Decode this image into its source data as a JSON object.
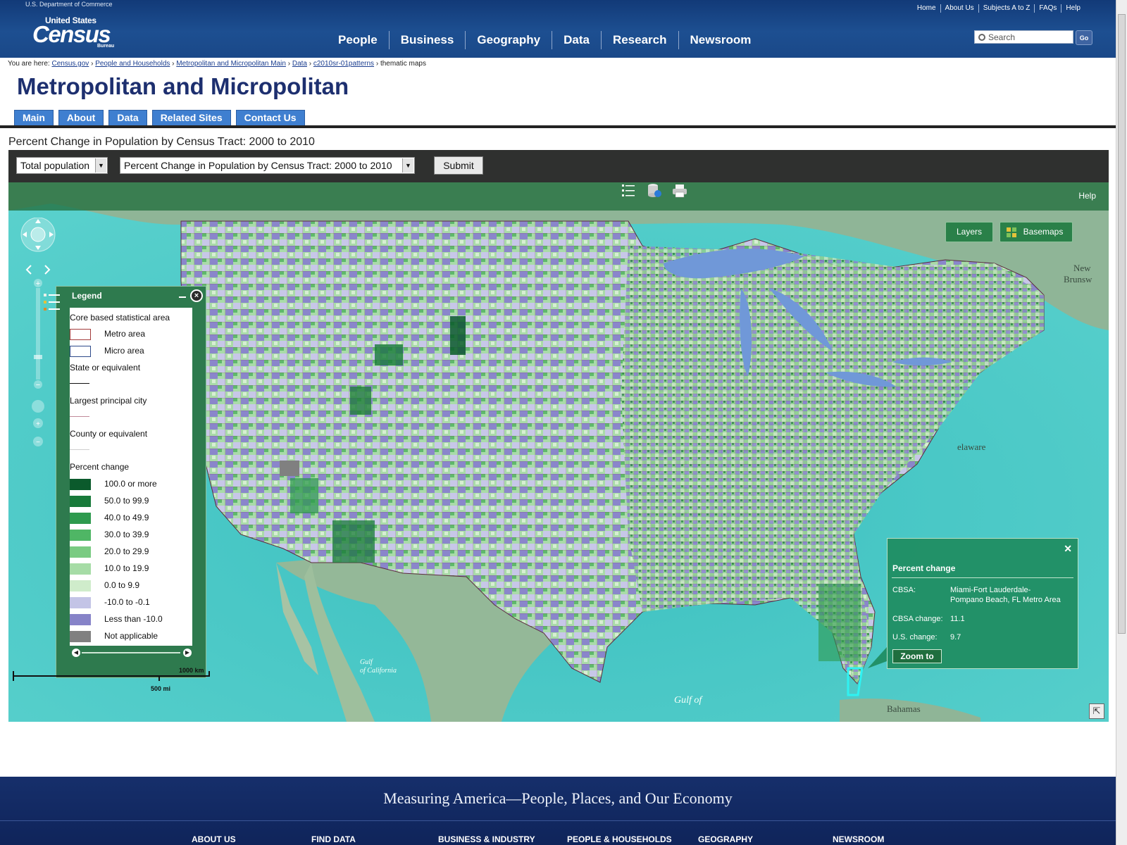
{
  "header": {
    "department": "U.S. Department of Commerce",
    "logo": {
      "top": "United States",
      "main": "Census",
      "sub": "Bureau"
    },
    "utility_links": [
      "Home",
      "About Us",
      "Subjects A to Z",
      "FAQs",
      "Help"
    ],
    "nav": [
      "People",
      "Business",
      "Geography",
      "Data",
      "Research",
      "Newsroom"
    ],
    "search": {
      "placeholder": "Search",
      "go_label": "Go"
    }
  },
  "breadcrumb": {
    "prefix": "You are here:",
    "links": [
      "Census.gov",
      "People and Households",
      "Metropolitan and Micropolitan Main",
      "Data",
      "c2010sr-01patterns"
    ],
    "current": "thematic maps",
    "separator": "›"
  },
  "page_title": "Metropolitan and Micropolitan",
  "subtabs": [
    "Main",
    "About",
    "Data",
    "Related Sites",
    "Contact Us"
  ],
  "map_title": "Percent Change in Population by Census Tract: 2000 to 2010",
  "controls": {
    "population_select": "Total population",
    "theme_select": "Percent Change in Population by Census Tract: 2000 to 2010",
    "submit_label": "Submit"
  },
  "map": {
    "toolbar_help": "Help",
    "buttons": {
      "layers": "Layers",
      "basemaps": "Basemaps"
    },
    "place_labels": {
      "gulf_california_1": "Gulf",
      "gulf_california_2": "of California",
      "gulf_mexico": "Gulf of",
      "bahamas": "Bahamas",
      "delaware": "elaware",
      "new_brunswick_1": "New",
      "new_brunswick_2": "Brunsw"
    },
    "scale": {
      "km": "1000 km",
      "mi": "500 mi"
    }
  },
  "legend": {
    "title": "Legend",
    "section_cbsa": "Core based statistical area",
    "metro": "Metro area",
    "micro": "Micro area",
    "state": "State or equivalent",
    "city": "Largest principal city",
    "county": "County or equivalent",
    "section_pct": "Percent change",
    "classes": [
      {
        "label": "100.0 or more",
        "color": "#0b5a2c"
      },
      {
        "label": "50.0 to 99.9",
        "color": "#187a3a"
      },
      {
        "label": "40.0 to 49.9",
        "color": "#2e9a4e"
      },
      {
        "label": "30.0 to 39.9",
        "color": "#4fb665"
      },
      {
        "label": "20.0 to 29.9",
        "color": "#7acb82"
      },
      {
        "label": "10.0 to 19.9",
        "color": "#a6dca6"
      },
      {
        "label": "0.0 to 9.9",
        "color": "#cfeccb"
      },
      {
        "label": "-10.0 to -0.1",
        "color": "#c3c4e6"
      },
      {
        "label": "Less than -10.0",
        "color": "#8683c8"
      },
      {
        "label": "Not applicable",
        "color": "#808080"
      }
    ],
    "metro_color": "#a23a3a",
    "micro_color": "#2e4a8a"
  },
  "popup": {
    "heading": "Percent change",
    "cbsa_key": "CBSA:",
    "cbsa_line1": "Miami-Fort Lauderdale-",
    "cbsa_line2": "Pompano Beach, FL Metro Area",
    "change_key": "CBSA change:",
    "change_val": "11.1",
    "us_key": "U.S. change:",
    "us_val": "9.7",
    "zoom_label": "Zoom to"
  },
  "footer": {
    "tagline": "Measuring America—People, Places, and Our Economy",
    "links": [
      "ABOUT US",
      "FIND DATA",
      "BUSINESS & INDUSTRY",
      "PEOPLE & HOUSEHOLDS",
      "GEOGRAPHY",
      "NEWSROOM"
    ]
  },
  "colors": {
    "header_blue": "#1d4f91",
    "ocean": "#47c5c4",
    "land": "#7fae8a",
    "accent_green": "#2e7a4e"
  }
}
